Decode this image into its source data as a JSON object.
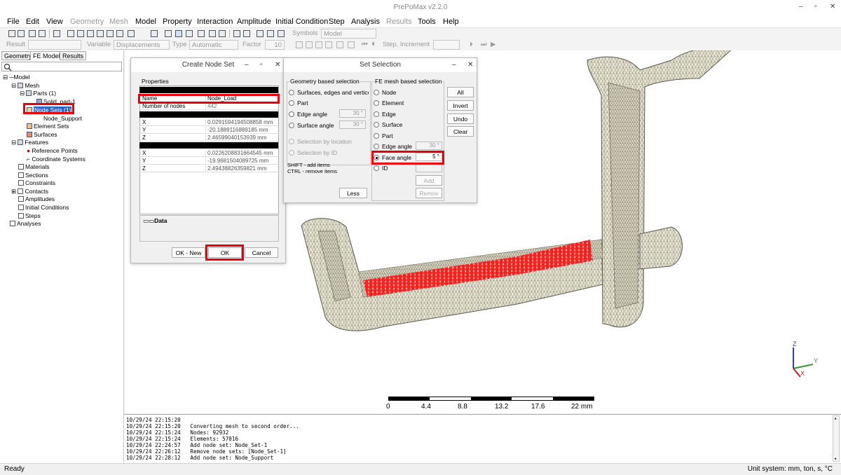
{
  "app": {
    "title": "PrePoMax v2.2.0",
    "win_min": "‒",
    "win_max": "▫",
    "win_close": "✕"
  },
  "menu": [
    "File",
    "Edit",
    "View",
    "Geometry",
    "Mesh",
    "Model",
    "Property",
    "Interaction",
    "Amplitude",
    "Initial Condition",
    "Step",
    "Analysis",
    "Results",
    "Tools",
    "Help"
  ],
  "menu_disabled": [
    "Geometry",
    "Mesh",
    "Results"
  ],
  "toolbar1": {
    "symbols_label": "Symbols",
    "symbols_value": "Model"
  },
  "toolbar2": {
    "result_label": "Result",
    "variable_label": "Variable",
    "variable_value": "Displacements",
    "type_label": "Type",
    "type_value": "Automatic",
    "factor_label": "Factor",
    "factor_value": "10",
    "step_label": "Step, Increment"
  },
  "tabs": [
    "Geometry",
    "FE Model",
    "Results"
  ],
  "tree": {
    "model": "Model",
    "mesh": "Mesh",
    "parts": "Parts (1)",
    "solid": "Solid_part-1",
    "node_sets": "Node Sets (1)",
    "node_support": "Node_Support",
    "element_sets": "Element Sets",
    "surfaces": "Surfaces",
    "features": "Features",
    "reference_points": "Reference Points",
    "coordinate_systems": "Coordinate Systems",
    "materials": "Materials",
    "sections": "Sections",
    "constraints": "Constraints",
    "contacts": "Contacts",
    "amplitudes": "Amplitudes",
    "initial_conditions": "Initial Conditions",
    "steps": "Steps",
    "analyses": "Analyses"
  },
  "create_node_set": {
    "title": "Create Node Set",
    "properties_label": "Properties",
    "name_key": "Name",
    "name_value": "Node_Load",
    "nodes_key": "Number of nodes",
    "nodes_value": "442",
    "x1": "0.0291594194508858 mm",
    "y1": "-20.1889116889185 mm",
    "z1": "2.49438826359821 mm",
    "x2": "0.0226208831664545 mm",
    "y2": "-19.9681504089725 mm",
    "z2": "2.46599040153939 mm",
    "x_key": "X",
    "y_key": "Y",
    "z_key": "Z",
    "data_label": "Data",
    "ok_new": "OK - New",
    "ok": "OK",
    "cancel": "Cancel"
  },
  "set_selection": {
    "title": "Set Selection",
    "geo_group": "Geometry based selection",
    "geo_items": [
      "Surfaces, edges and vertices",
      "Part",
      "Edge angle",
      "Surface angle"
    ],
    "geo_edge_angle": "30 °",
    "geo_surface_angle": "30 °",
    "sel_by_location": "Selection by location",
    "sel_by_id": "Selection by ID",
    "shift_hint": "SHIFT - add items",
    "ctrl_hint": "CTRL - remove items",
    "less": "Less",
    "fe_group": "FE mesh based selection",
    "fe_items": [
      "Node",
      "Element",
      "Edge",
      "Surface",
      "Part",
      "Edge angle",
      "Face angle",
      "ID"
    ],
    "fe_edge_angle": "30 °",
    "fe_face_angle": "5 °",
    "btn_all": "All",
    "btn_invert": "Invert",
    "btn_undo": "Undo",
    "btn_clear": "Clear",
    "btn_add": "Add",
    "btn_remove": "Remov"
  },
  "scale": {
    "labels": [
      "0",
      "4.4",
      "8.8",
      "13.2",
      "17.6",
      "22 mm"
    ]
  },
  "triad": {
    "x": "X",
    "y": "Y",
    "z": "Z"
  },
  "log": [
    "10/29/24 22:15:20",
    "10/29/24 22:15:20   Converting mesh to second order...",
    "10/29/24 22:15:24   Nodes: 92932",
    "10/29/24 22:15:24   Elements: 57016",
    "10/29/24 22:24:57   Add node set: Node_Set-1",
    "10/29/24 22:26:12   Remove node sets: [Node_Set-1]",
    "10/29/24 22:28:12   Add node set: Node_Support"
  ],
  "status": {
    "left": "Ready",
    "right": "Unit system: mm, ton, s, °C"
  },
  "colors": {
    "selection_red": "#ff1e1e",
    "highlight": "#e8000a",
    "mesh_fill": "#ece9d6"
  }
}
